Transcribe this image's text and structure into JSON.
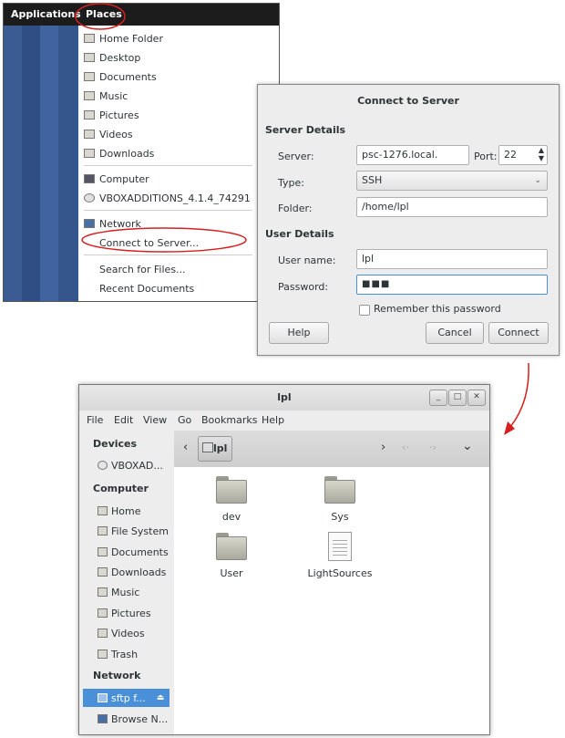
{
  "places_menu": {
    "topbar": {
      "applications": "Applications",
      "places": "Places"
    },
    "items": [
      {
        "label": "Home Folder",
        "icon": "folder-icon"
      },
      {
        "label": "Desktop",
        "icon": "folder-icon"
      },
      {
        "label": "Documents",
        "icon": "folder-icon"
      },
      {
        "label": "Music",
        "icon": "folder-icon"
      },
      {
        "label": "Pictures",
        "icon": "folder-icon"
      },
      {
        "label": "Videos",
        "icon": "folder-icon"
      },
      {
        "label": "Downloads",
        "icon": "folder-icon"
      }
    ],
    "computer": "Computer",
    "vbox": "VBOXADDITIONS_4.1.4_74291",
    "network": "Network",
    "connect": "Connect to Server...",
    "search": "Search for Files...",
    "recent": "Recent Documents"
  },
  "dialog": {
    "title": "Connect to Server",
    "server_details": "Server Details",
    "server_label": "Server:",
    "server_value": "psc-1276.local.",
    "port_label": "Port:",
    "port_value": "22",
    "type_label": "Type:",
    "type_value": "SSH",
    "folder_label": "Folder:",
    "folder_value": "/home/lpl",
    "user_details": "User Details",
    "username_label": "User name:",
    "username_value": "lpl",
    "password_label": "Password:",
    "password_value": "■■■",
    "remember": "Remember this password",
    "help": "Help",
    "cancel": "Cancel",
    "connect": "Connect"
  },
  "file_manager": {
    "title": "lpl",
    "menu": [
      "File",
      "Edit",
      "View",
      "Go",
      "Bookmarks",
      "Help"
    ],
    "sidebar": {
      "devices": "Devices",
      "vbox": "VBOXAD...",
      "computer": "Computer",
      "computer_items": [
        "Home",
        "File System",
        "Documents",
        "Downloads",
        "Music",
        "Pictures",
        "Videos",
        "Trash"
      ],
      "network": "Network",
      "sftp": "sftp f...",
      "browse": "Browse N..."
    },
    "path_button": "lpl",
    "files": [
      {
        "name": "dev",
        "kind": "folder"
      },
      {
        "name": "Sys",
        "kind": "folder"
      },
      {
        "name": "User",
        "kind": "folder"
      },
      {
        "name": "LightSources",
        "kind": "file"
      }
    ]
  },
  "colors": {
    "annotation": "#d62020",
    "selection": "#4a90d9",
    "topbar": "#1c1c1c"
  }
}
